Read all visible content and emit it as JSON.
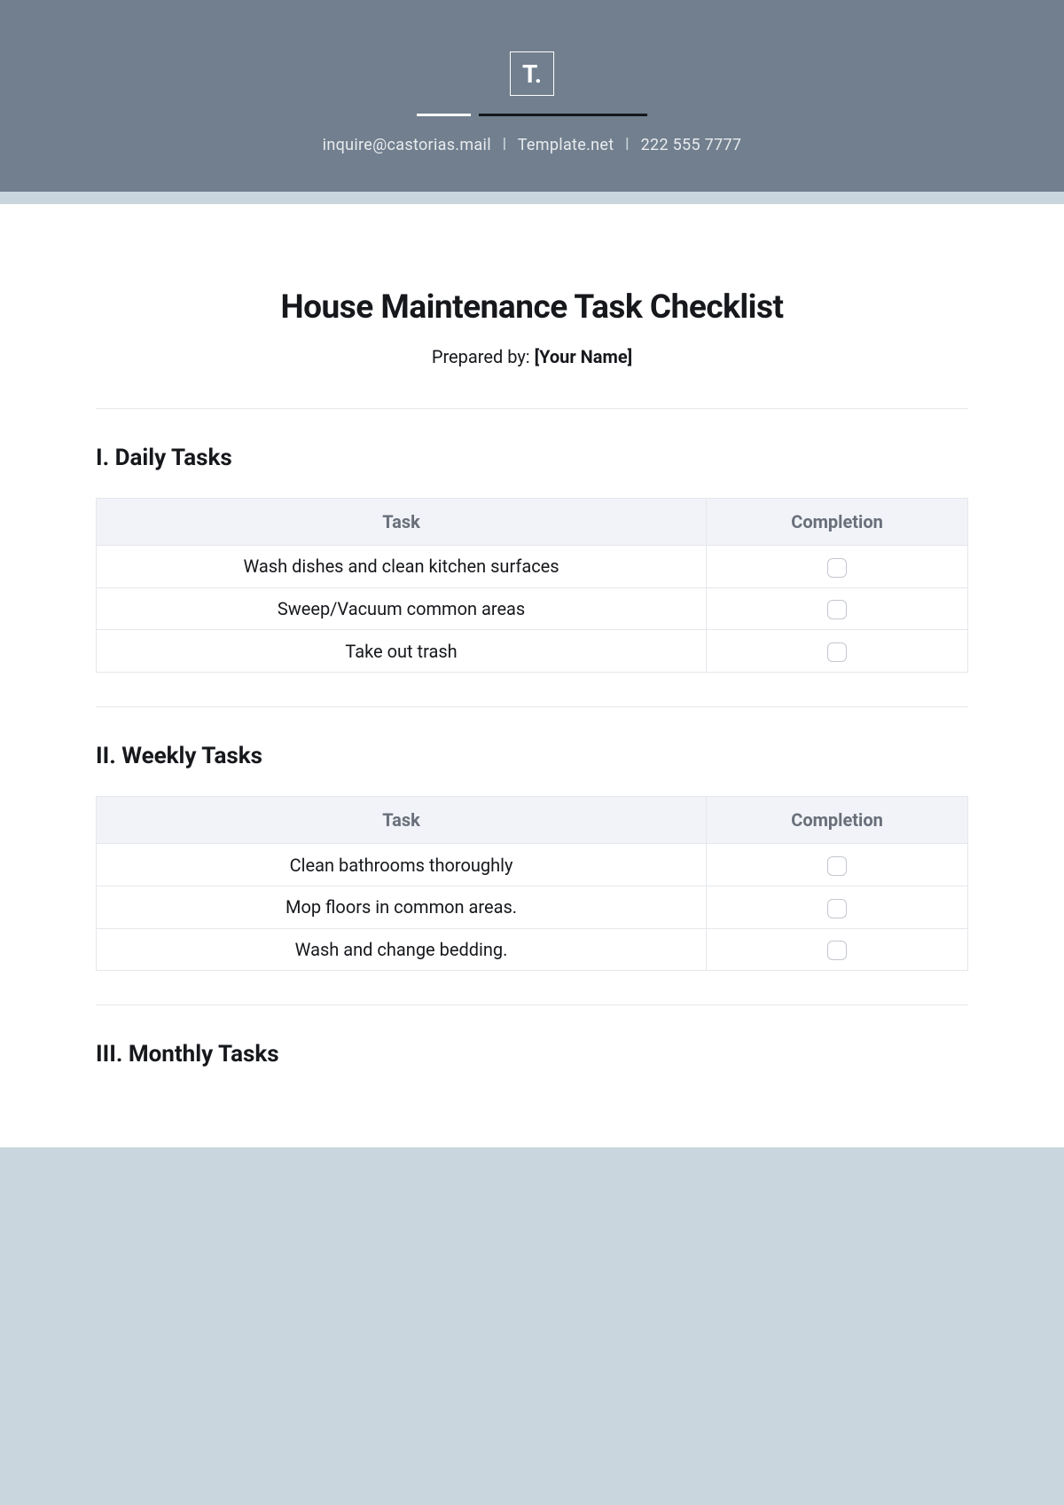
{
  "header": {
    "logo_text": "T.",
    "email": "inquire@castorias.mail",
    "site": "Template.net",
    "phone": "222 555 7777"
  },
  "document": {
    "title": "House Maintenance Task Checklist",
    "prepared_by_label": "Prepared by: ",
    "prepared_by_value": "[Your Name]"
  },
  "table_headers": {
    "task": "Task",
    "completion": "Completion"
  },
  "sections": [
    {
      "title": "I. Daily Tasks",
      "tasks": [
        "Wash dishes and clean kitchen surfaces",
        "Sweep/Vacuum common areas",
        "Take out trash"
      ]
    },
    {
      "title": "II. Weekly Tasks",
      "tasks": [
        "Clean bathrooms thoroughly",
        "Mop floors in common areas.",
        "Wash and change bedding."
      ]
    },
    {
      "title": "III. Monthly Tasks",
      "tasks": []
    }
  ]
}
